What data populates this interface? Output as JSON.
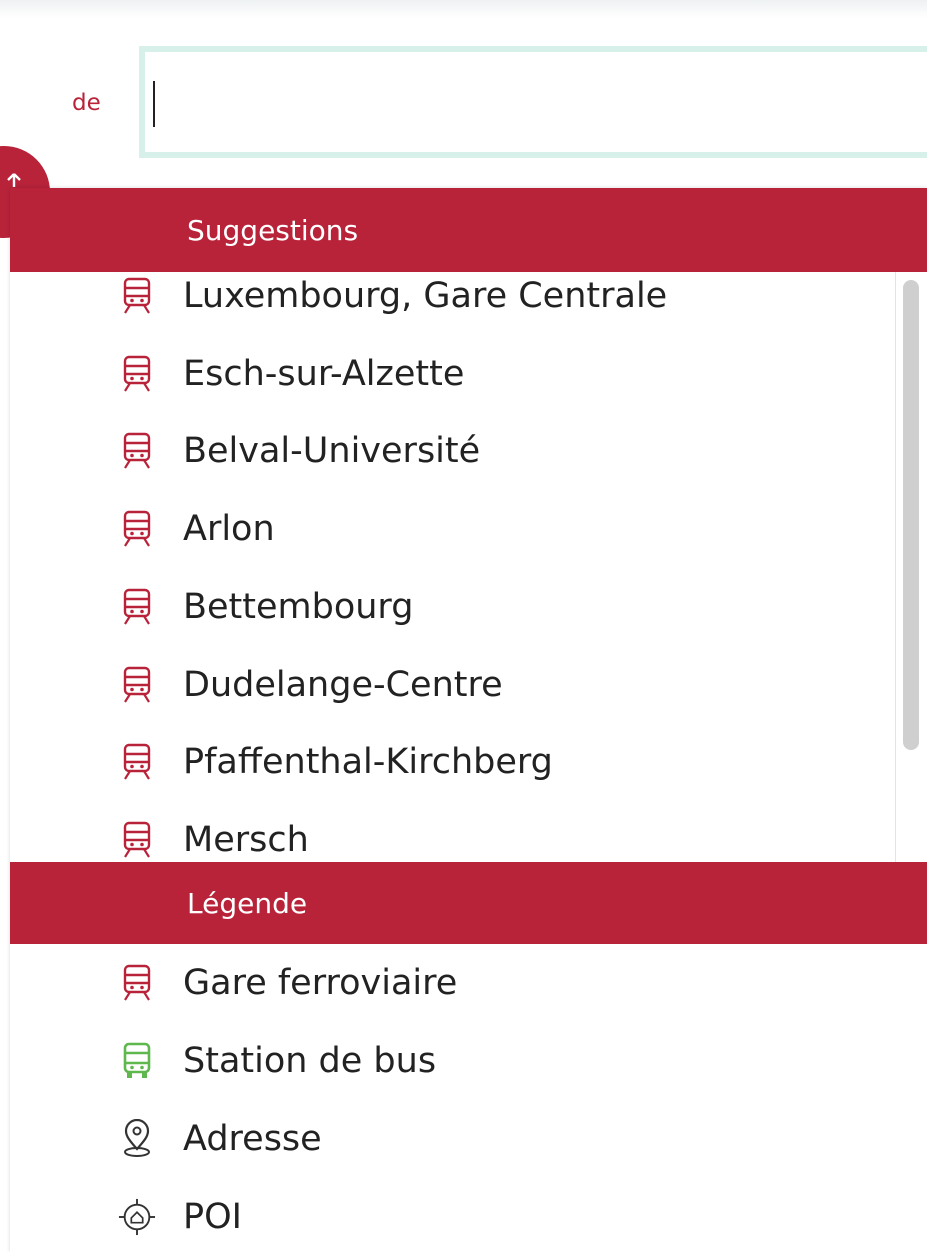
{
  "search": {
    "from_label": "de",
    "from_value": ""
  },
  "suggestions": {
    "header": "Suggestions",
    "items": [
      {
        "label": "Luxembourg, Gare Centrale",
        "icon": "train-icon"
      },
      {
        "label": "Esch-sur-Alzette",
        "icon": "train-icon"
      },
      {
        "label": "Belval-Université",
        "icon": "train-icon"
      },
      {
        "label": "Arlon",
        "icon": "train-icon"
      },
      {
        "label": "Bettembourg",
        "icon": "train-icon"
      },
      {
        "label": "Dudelange-Centre",
        "icon": "train-icon"
      },
      {
        "label": "Pfaffenthal-Kirchberg",
        "icon": "train-icon"
      },
      {
        "label": "Mersch",
        "icon": "train-icon"
      }
    ]
  },
  "legend": {
    "header": "Légende",
    "items": [
      {
        "label": "Gare ferroviaire",
        "icon": "train-icon"
      },
      {
        "label": "Station de bus",
        "icon": "bus-icon"
      },
      {
        "label": "Adresse",
        "icon": "location-pin-icon"
      },
      {
        "label": "POI",
        "icon": "poi-target-icon"
      }
    ]
  },
  "colors": {
    "brand": "#b8233a",
    "bus": "#5fb84e",
    "input_border": "#d7f0ea"
  }
}
